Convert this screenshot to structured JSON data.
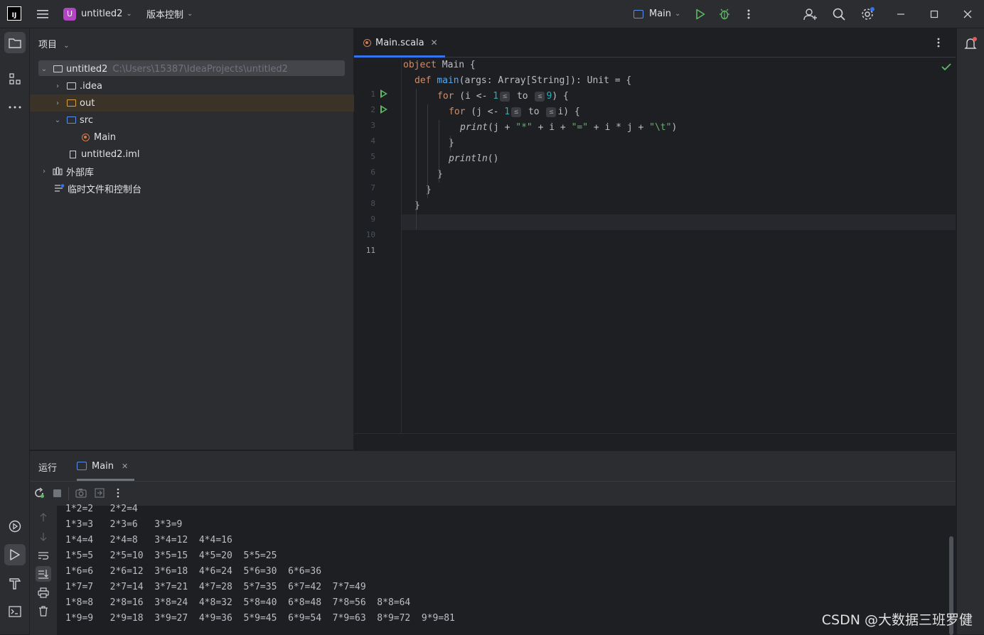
{
  "titlebar": {
    "logo_text": "IJ",
    "project_badge": "U",
    "project_name": "untitled2",
    "vcs_label": "版本控制",
    "run_config": "Main"
  },
  "project_panel": {
    "title": "项目",
    "root_name": "untitled2",
    "root_path": "C:\\Users\\15387\\IdeaProjects\\untitled2",
    "items": [
      {
        "label": ".idea"
      },
      {
        "label": "out"
      },
      {
        "label": "src"
      },
      {
        "label": "Main"
      },
      {
        "label": "untitled2.iml"
      },
      {
        "label": "外部库"
      },
      {
        "label": "临时文件和控制台"
      }
    ]
  },
  "editor": {
    "tab_label": "Main.scala",
    "line_numbers": [
      "1",
      "2",
      "3",
      "4",
      "5",
      "6",
      "7",
      "8",
      "9",
      "10",
      "11"
    ],
    "code": {
      "l1_kw": "object",
      "l1_rest": " Main {",
      "l2_kw": "def",
      "l2_fn": "main",
      "l2_rest": "(args: Array[String]): Unit = {",
      "l3_kw": "for",
      "l3_a": " (i <- ",
      "l3_num1": "1",
      "l3_hint1": "≤",
      "l3_to": " to ",
      "l3_hint2": "≤",
      "l3_num2": "9",
      "l3_b": ") {",
      "l4_kw": "for",
      "l4_a": " (j <- ",
      "l4_num1": "1",
      "l4_hint1": "≤",
      "l4_to": " to ",
      "l4_hint2": "≤",
      "l4_b": "i) {",
      "l5_fn": "print",
      "l5_a": "(j + ",
      "l5_s1": "\"*\"",
      "l5_b": " + i + ",
      "l5_s2": "\"=\"",
      "l5_c": " + i * j + ",
      "l5_s3": "\"\\t\"",
      "l5_d": ")",
      "l6": "}",
      "l7_fn": "println",
      "l7_rest": "()",
      "l8": "}",
      "l9": "}",
      "l10": "}"
    }
  },
  "run_panel": {
    "title": "运行",
    "tab_label": "Main",
    "output": [
      "1*2=2   2*2=4",
      "1*3=3   2*3=6   3*3=9",
      "1*4=4   2*4=8   3*4=12  4*4=16",
      "1*5=5   2*5=10  3*5=15  4*5=20  5*5=25",
      "1*6=6   2*6=12  3*6=18  4*6=24  5*6=30  6*6=36",
      "1*7=7   2*7=14  3*7=21  4*7=28  5*7=35  6*7=42  7*7=49",
      "1*8=8   2*8=16  3*8=24  4*8=32  5*8=40  6*8=48  7*8=56  8*8=64",
      "1*9=9   2*9=18  3*9=27  4*9=36  5*9=45  6*9=54  7*9=63  8*9=72  9*9=81"
    ]
  },
  "watermark": "CSDN @大数据三班罗健"
}
